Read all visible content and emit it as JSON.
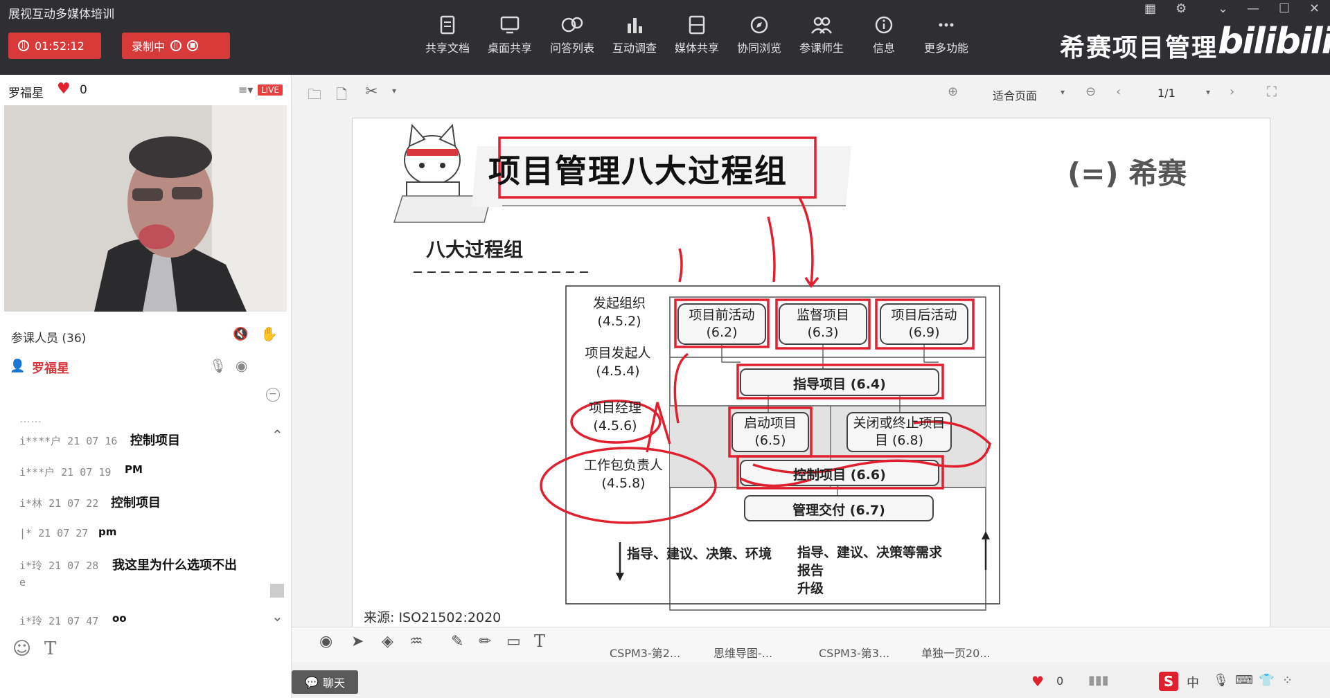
{
  "app": {
    "title": "展视互动多媒体培训"
  },
  "recording": {
    "timer": "01:52:12",
    "rec_label": "录制中"
  },
  "toolbar": {
    "items": [
      {
        "label": "共享文档",
        "icon": "document-icon"
      },
      {
        "label": "桌面共享",
        "icon": "desktop-icon"
      },
      {
        "label": "问答列表",
        "icon": "qa-icon"
      },
      {
        "label": "互动调查",
        "icon": "chart-icon"
      },
      {
        "label": "媒体共享",
        "icon": "film-icon"
      },
      {
        "label": "协同浏览",
        "icon": "compass-icon"
      },
      {
        "label": "参课师生",
        "icon": "users-icon"
      },
      {
        "label": "信息",
        "icon": "info-icon"
      },
      {
        "label": "更多功能",
        "icon": "more-icon"
      }
    ]
  },
  "brand": {
    "text": "希赛项目管理",
    "logo": "bilibili"
  },
  "presenter": {
    "name": "罗福星",
    "likes": "0",
    "live": "LIVE"
  },
  "participants": {
    "label": "参课人员 (36)",
    "self": "罗福星"
  },
  "chat": [
    {
      "meta": "i****户 21 07 16",
      "text": "控制项目"
    },
    {
      "meta": "i***户 21 07 19",
      "text": "PM"
    },
    {
      "meta": "i*林 21 07 22",
      "text": "控制项目"
    },
    {
      "meta": "|* 21 07 27",
      "text": "pm"
    },
    {
      "meta": "i*玲 21 07 28",
      "text": "我这里为什么选项不出"
    },
    {
      "meta": "i*玲 21 07 47",
      "text": "oo"
    }
  ],
  "chat_cont": "e",
  "chat_button": "聊天",
  "doc_toolbar": {
    "zoom": "适合页面",
    "page": "1/1"
  },
  "slide": {
    "title": "项目管理八大过程组",
    "subtitle": "八大过程组",
    "logo": "希赛",
    "source": "来源:  ISO21502:2020",
    "roles": [
      {
        "name": "发起组织",
        "code": "(4.5.2)"
      },
      {
        "name": "项目发起人",
        "code": "(4.5.4)"
      },
      {
        "name": "项目经理",
        "code": "(4.5.6)"
      },
      {
        "name": "工作包负责人",
        "code": "(4.5.8)"
      }
    ],
    "boxes": {
      "pre": {
        "name": "项目前活动",
        "code": "(6.2)"
      },
      "oversee": {
        "name": "监督项目",
        "code": "(6.3)"
      },
      "post": {
        "name": "项目后活动",
        "code": "(6.9)"
      },
      "direct": "指导项目 (6.4)",
      "initiate": {
        "name": "启动项目",
        "code": "(6.5)"
      },
      "close": {
        "name": "关闭或终止项目",
        "code": "目 (6.8)"
      },
      "control": "控制项目 (6.6)",
      "deliver": "管理交付 (6.7)"
    },
    "down_note": "指导、建议、决策、环境",
    "up_note": [
      "指导、建议、决策等需求",
      "报告",
      "升级"
    ]
  },
  "doc_tabs": [
    "CSPM3-第2...",
    "思维导图-...",
    "CSPM3-第3...",
    "单独一页20..."
  ],
  "taskbar": {
    "likes": "0",
    "ime": "中"
  },
  "colors": {
    "topbar": "#2e2e33",
    "rec": "#d83a3a",
    "annotation": "#e0202e"
  }
}
